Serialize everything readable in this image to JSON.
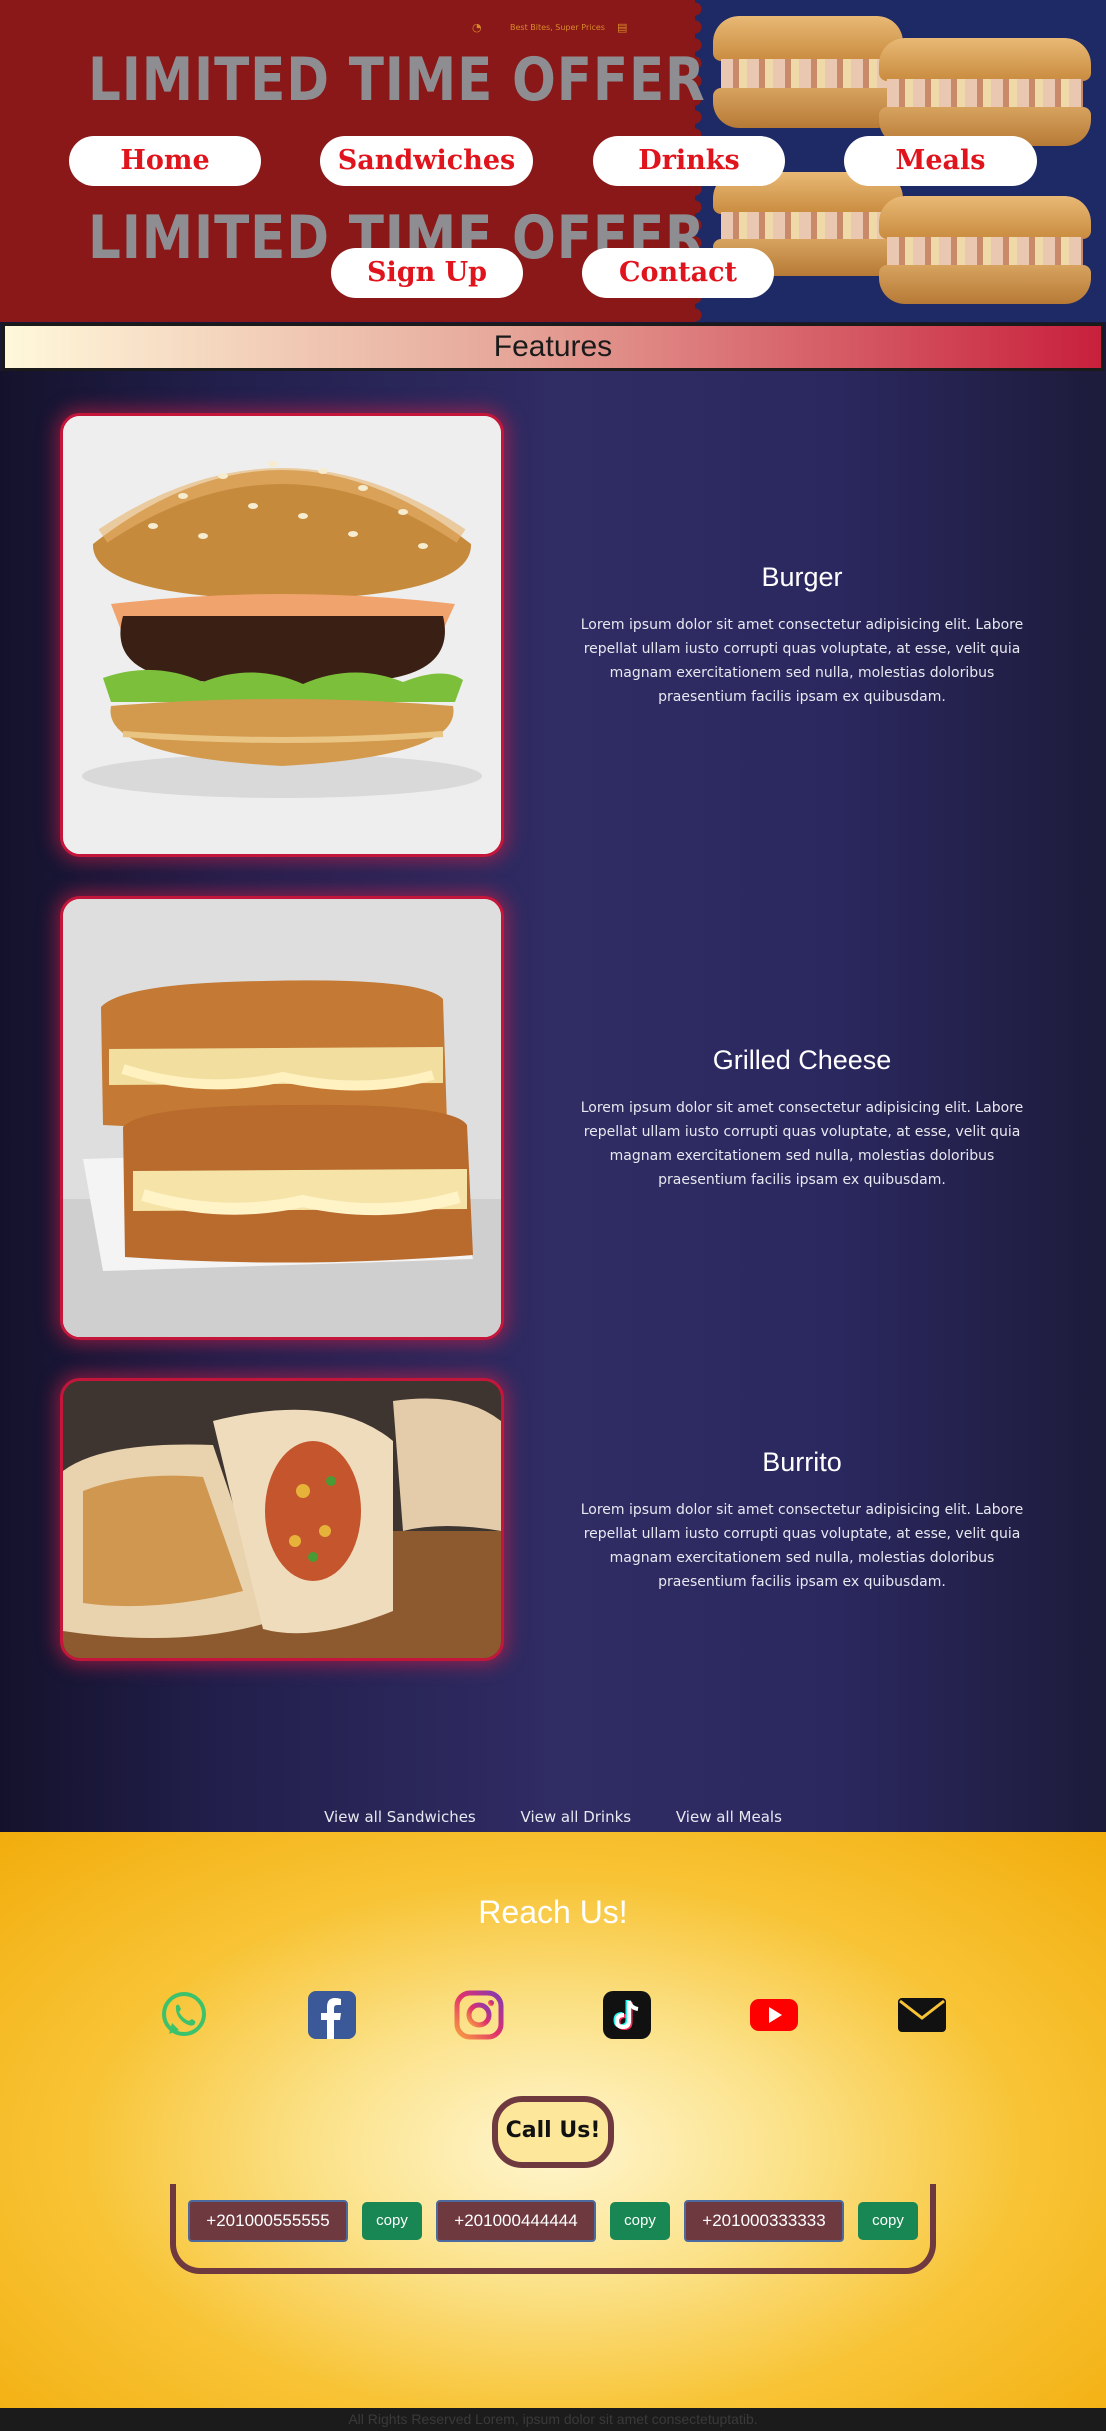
{
  "hero": {
    "promo_text": "LIMITED TIME OFFER",
    "promo_text_2": "LIMITED TIME OFFER",
    "small_text": "Best Bites, Super Prices",
    "bg_color": "#8a1818"
  },
  "nav": {
    "items": [
      {
        "label": "Home"
      },
      {
        "label": "Sandwiches"
      },
      {
        "label": "Drinks"
      },
      {
        "label": "Meals"
      },
      {
        "label": "Sign Up"
      },
      {
        "label": "Contact"
      }
    ],
    "text_color": "#e0141c"
  },
  "features_heading": "Features",
  "features": [
    {
      "title": "Burger",
      "text": "Lorem ipsum dolor sit amet consectetur adipisicing elit. Labore repellat ullam iusto corrupti quas voluptate, at esse, velit quia magnam exercitationem sed nulla, molestias doloribus praesentium facilis ipsam ex quibusdam.",
      "image": "burger-photo"
    },
    {
      "title": "Grilled Cheese",
      "text": "Lorem ipsum dolor sit amet consectetur adipisicing elit. Labore repellat ullam iusto corrupti quas voluptate, at esse, velit quia magnam exercitationem sed nulla, molestias doloribus praesentium facilis ipsam ex quibusdam.",
      "image": "grilled-cheese-photo"
    },
    {
      "title": "Burrito",
      "text": "Lorem ipsum dolor sit amet consectetur adipisicing elit. Labore repellat ullam iusto corrupti quas voluptate, at esse, velit quia magnam exercitationem sed nulla, molestias doloribus praesentium facilis ipsam ex quibusdam.",
      "image": "burrito-photo"
    }
  ],
  "view_links": [
    {
      "label": "View all Sandwiches"
    },
    {
      "label": "View all Drinks"
    },
    {
      "label": "View all Meals"
    }
  ],
  "footer": {
    "heading": "Reach Us!",
    "social": [
      "whatsapp-icon",
      "facebook-icon",
      "instagram-icon",
      "tiktok-icon",
      "youtube-icon",
      "email-icon"
    ],
    "call_label": "Call Us!",
    "phones": [
      {
        "number": "+201000555555",
        "copy_label": "copy"
      },
      {
        "number": "+201000444444",
        "copy_label": "copy"
      },
      {
        "number": "+201000333333",
        "copy_label": "copy"
      }
    ],
    "copyright": "All Rights Reserved Lorem, ipsum dolor sit amet consectetuptatib."
  },
  "colors": {
    "accent_red": "#c4163a",
    "copy_green": "#198754",
    "phone_bg": "#6e3a40",
    "footer_yellow": "#f8c436"
  }
}
